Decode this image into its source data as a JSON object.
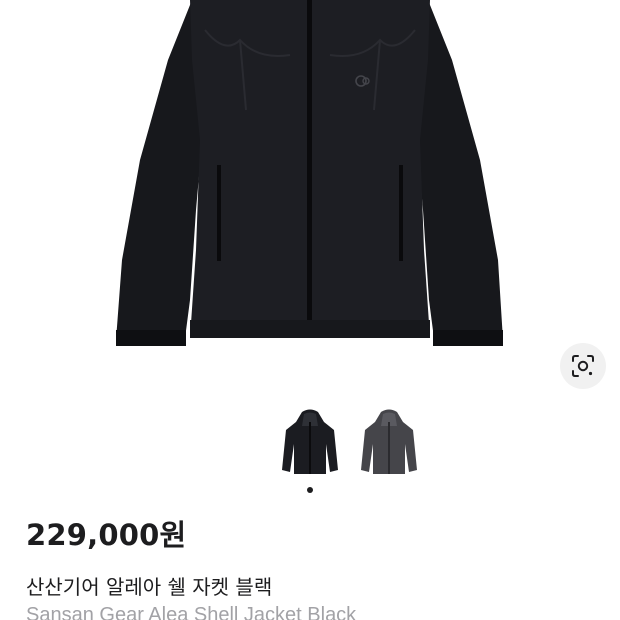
{
  "product": {
    "price": "229,000원",
    "name_ko": "산산기어 알레아 쉘 자켓 블랙",
    "name_en": "Sansan Gear Alea Shell Jacket Black"
  },
  "gallery": {
    "main_image": "black-shell-jacket",
    "lens_icon": "visual-search-icon",
    "thumbnails": [
      {
        "variant": "black",
        "color": "#1b1c21",
        "selected": true
      },
      {
        "variant": "charcoal",
        "color": "#45454a",
        "selected": false
      }
    ],
    "page_indicator": {
      "current": 1,
      "total": 1
    }
  },
  "colors": {
    "jacket_black": "#1b1c21",
    "jacket_charcoal": "#45454a",
    "text_primary": "#1d1d1f",
    "text_secondary": "#a2a2a6"
  }
}
